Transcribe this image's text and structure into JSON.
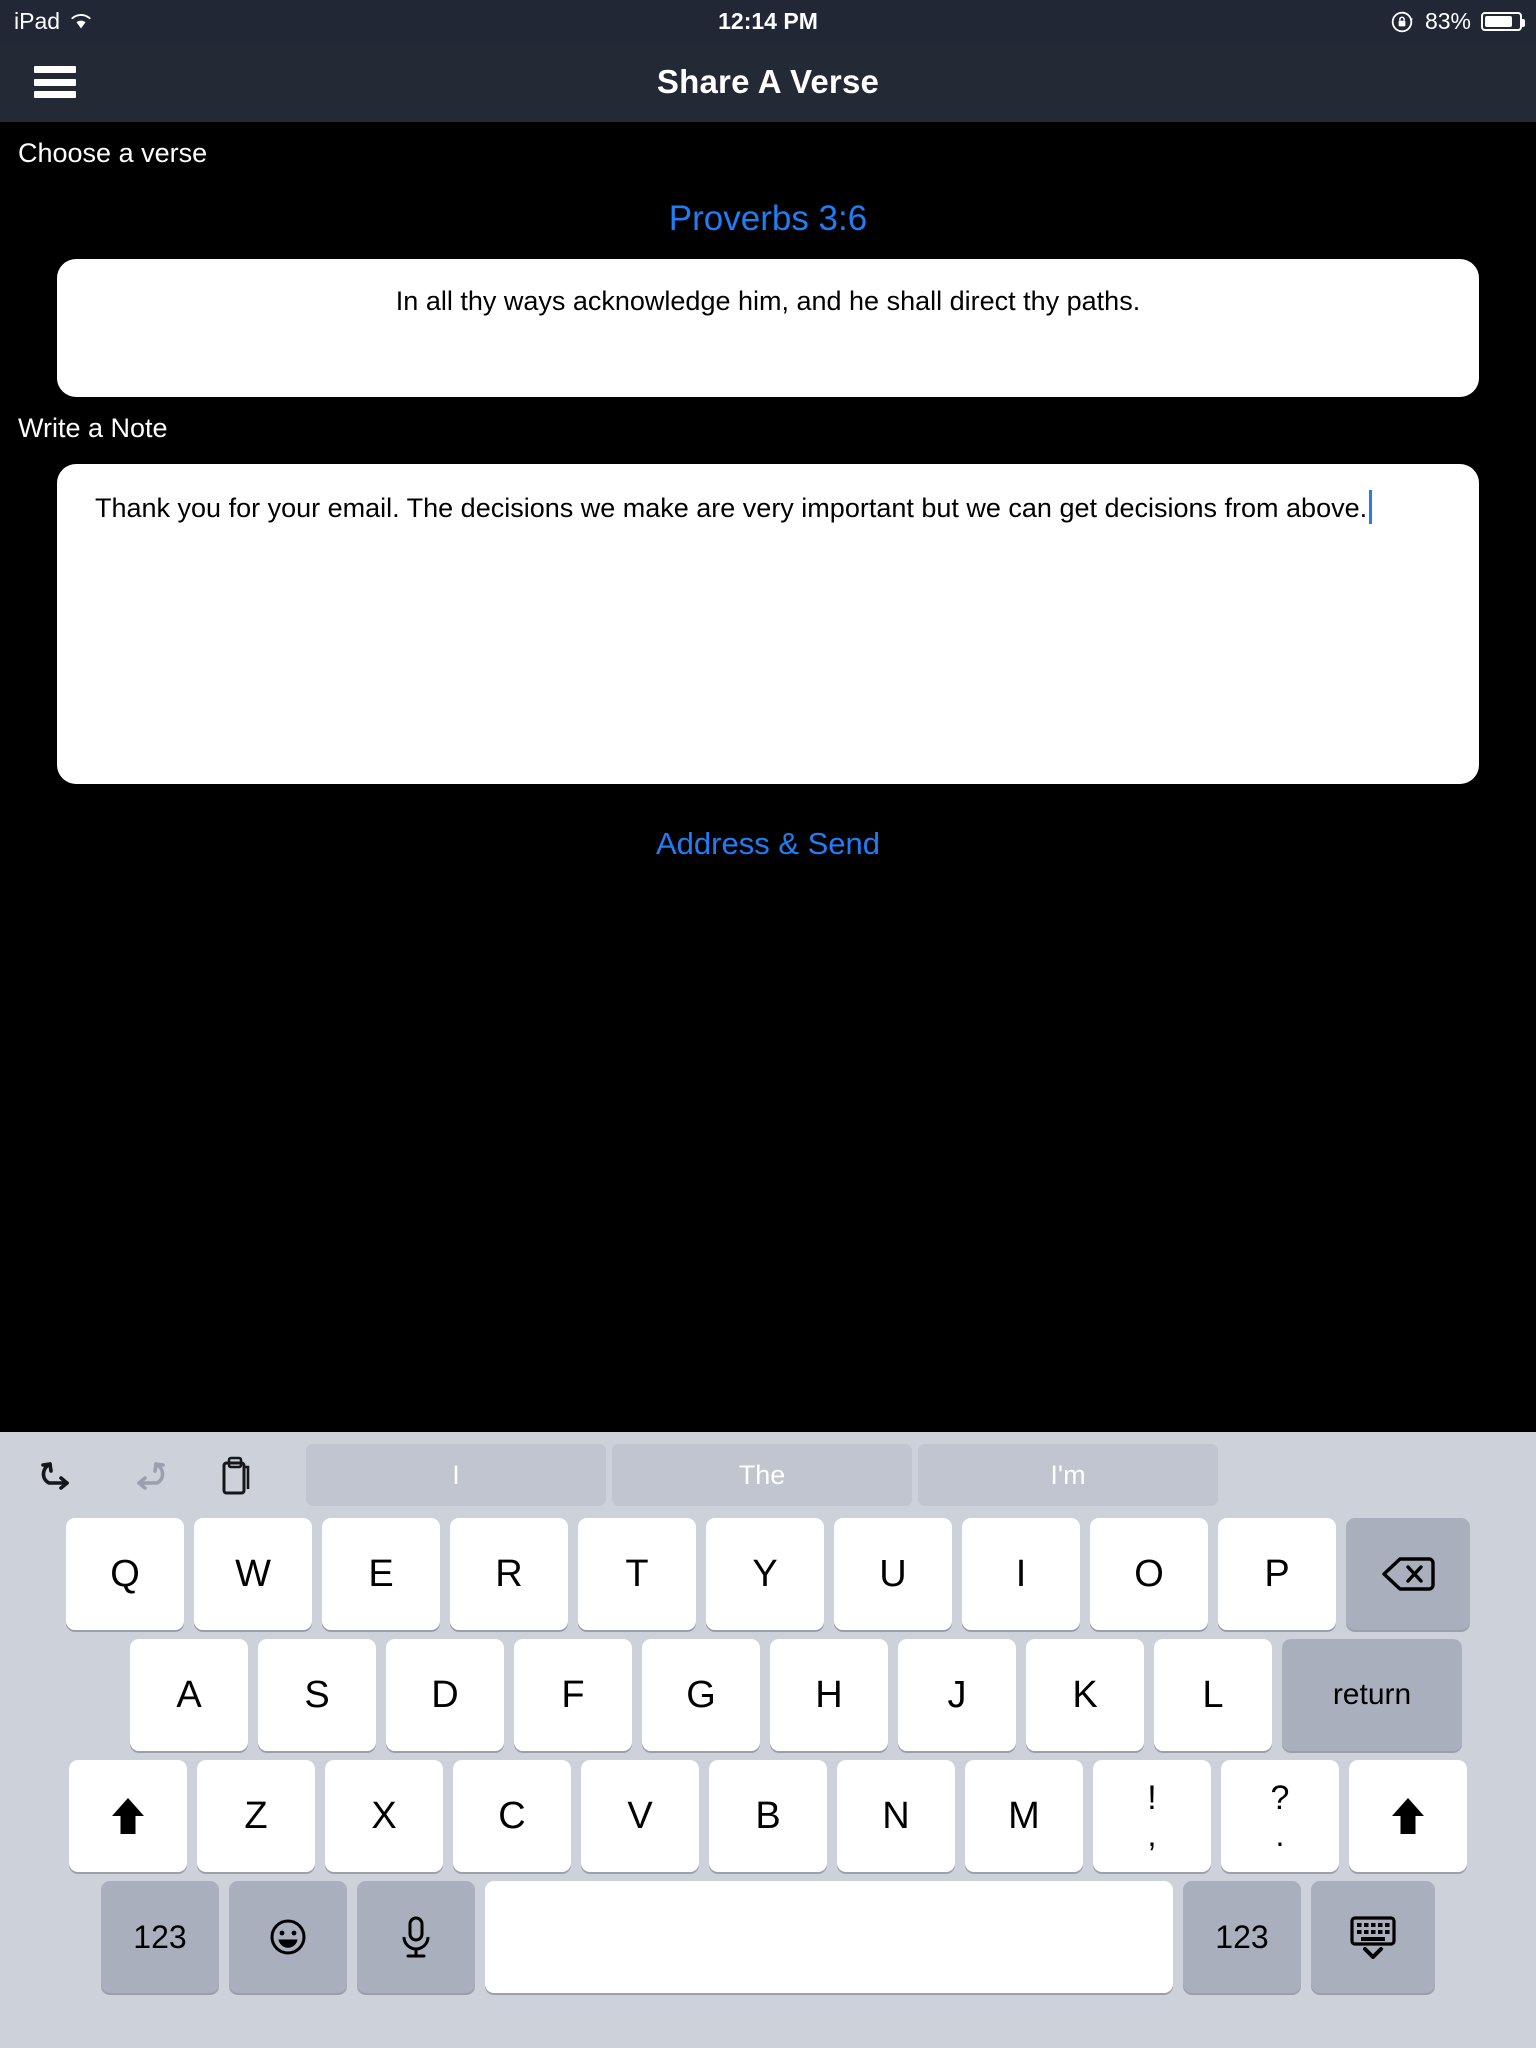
{
  "status_bar": {
    "device": "iPad",
    "wifi_icon": "wifi-icon",
    "time": "12:14 PM",
    "rotation_lock_icon": "rotation-lock-icon",
    "battery_percent": "83%",
    "battery_level": 83
  },
  "nav_bar": {
    "menu_icon": "hamburger-menu-icon",
    "title": "Share A Verse"
  },
  "content": {
    "verse_section_label": "Choose a verse",
    "verse_reference": "Proverbs 3:6",
    "verse_text": "In all thy ways acknowledge him, and he shall direct thy paths.",
    "note_section_label": "Write a Note",
    "note_text": "Thank you for your email. The decisions we make are very important but we can get decisions from above.",
    "send_link_label": "Address & Send"
  },
  "colors": {
    "accent_blue": "#1f7df5",
    "nav_background": "#242936",
    "status_background": "#222736",
    "content_background": "#000000",
    "card_background": "#ffffff",
    "keyboard_background": "#CDD1D9",
    "key_background": "#ffffff",
    "key_dark_background": "#A9AFBC",
    "suggestion_background": "#C0C5CF",
    "caret_color": "#2a7bf0"
  },
  "keyboard": {
    "toolbar": {
      "undo_icon": "undo-icon",
      "redo_icon": "redo-icon",
      "paste_icon": "paste-clipboard-icon"
    },
    "suggestions": [
      "I",
      "The",
      "I'm"
    ],
    "row1": [
      "Q",
      "W",
      "E",
      "R",
      "T",
      "Y",
      "U",
      "I",
      "O",
      "P"
    ],
    "backspace_icon": "backspace-delete-icon",
    "row2": [
      "A",
      "S",
      "D",
      "F",
      "G",
      "H",
      "J",
      "K",
      "L"
    ],
    "return_label": "return",
    "row3": [
      "Z",
      "X",
      "C",
      "V",
      "B",
      "N",
      "M"
    ],
    "shift_left_icon": "shift-arrow-up-icon",
    "shift_right_icon": "shift-arrow-up-icon",
    "punct_exclaim_top": "!",
    "punct_exclaim_bottom": ",",
    "punct_question_top": "?",
    "punct_question_bottom": ".",
    "numbers_left_label": "123",
    "numbers_right_label": "123",
    "emoji_icon": "emoji-smiley-icon",
    "dictation_icon": "microphone-icon",
    "space_label": "",
    "dismiss_keyboard_icon": "hide-keyboard-icon"
  }
}
